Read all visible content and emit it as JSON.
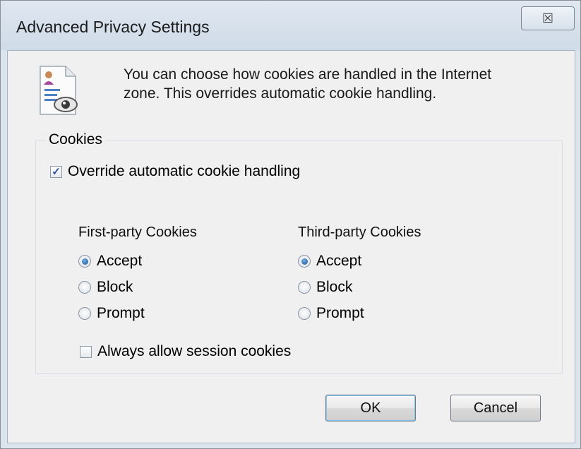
{
  "window": {
    "title": "Advanced Privacy Settings",
    "close_glyph": "☒"
  },
  "intro": {
    "line1": "You can choose how cookies are handled in the Internet",
    "line2": "zone.  This overrides automatic cookie handling."
  },
  "cookies": {
    "group_label": "Cookies",
    "override": {
      "label": "Override automatic cookie handling",
      "checked": true
    },
    "first_party": {
      "label": "First-party Cookies",
      "options": [
        "Accept",
        "Block",
        "Prompt"
      ],
      "selected": "Accept"
    },
    "third_party": {
      "label": "Third-party Cookies",
      "options": [
        "Accept",
        "Block",
        "Prompt"
      ],
      "selected": "Accept"
    },
    "session": {
      "label": "Always allow session cookies",
      "checked": false
    }
  },
  "buttons": {
    "ok": "OK",
    "cancel": "Cancel"
  },
  "colors": {
    "accent": "#1b4f8a",
    "frame": "#dbe3ec"
  }
}
